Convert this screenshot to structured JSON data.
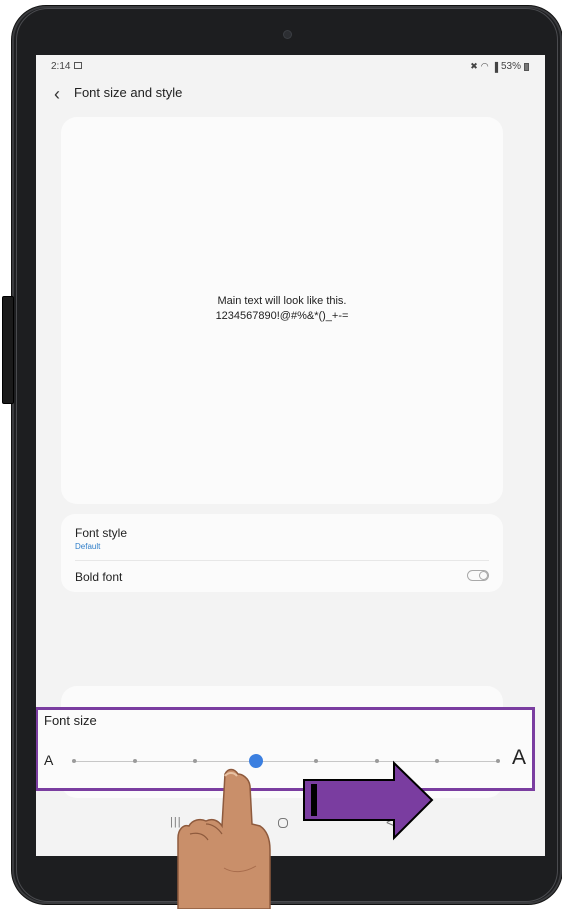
{
  "status_bar": {
    "time": "2:14",
    "battery": "53%"
  },
  "header": {
    "back_icon": "chevron-left-icon",
    "title": "Font size and style"
  },
  "preview": {
    "line1": "Main text will look like this.",
    "line2": "1234567890!@#%&*()_+-="
  },
  "settings": {
    "font_style_label": "Font style",
    "font_style_value": "Default",
    "bold_font_label": "Bold font",
    "bold_font_enabled": false
  },
  "font_size": {
    "label": "Font size",
    "small_a": "A",
    "large_a": "A",
    "steps": 8,
    "selected_index": 3
  },
  "navbar": {
    "recent_glyph": "|||",
    "back_glyph": "<"
  },
  "colors": {
    "accent": "#3b7fe0",
    "highlight_border": "#7a3da0",
    "arrow_fill": "#7a3da0",
    "link_blue": "#2f7ec9"
  }
}
